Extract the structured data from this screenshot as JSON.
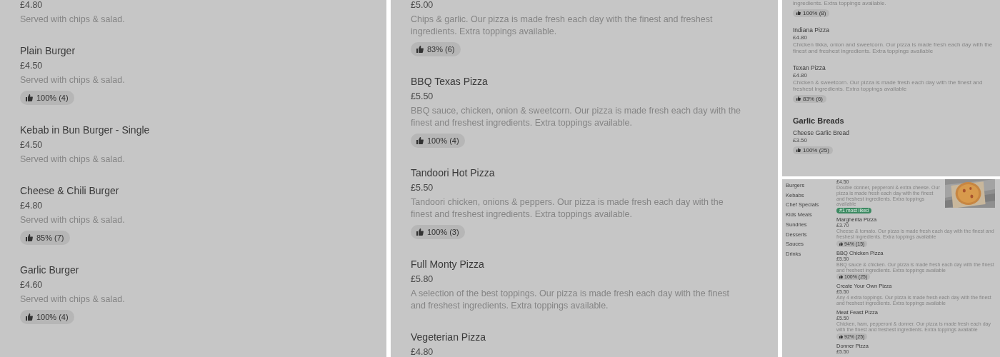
{
  "panels": [
    {
      "kind": "wide",
      "items": [
        {
          "kind": "dish",
          "price": "£4.80",
          "description": "Served with chips & salad."
        },
        {
          "kind": "dish",
          "name": "Plain Burger",
          "price": "£4.50",
          "description": "Served with chips & salad.",
          "rating": "100% (4)"
        },
        {
          "kind": "dish",
          "name": "Kebab in Bun Burger - Single",
          "price": "£4.50",
          "description": "Served with chips & salad."
        },
        {
          "kind": "dish",
          "name": "Cheese & Chili Burger",
          "price": "£4.80",
          "description": "Served with chips & salad.",
          "rating": "85% (7)"
        },
        {
          "kind": "dish",
          "name": "Garlic Burger",
          "price": "£4.60",
          "description": "Served with chips & salad.",
          "rating": "100% (4)"
        }
      ]
    },
    {
      "kind": "wide",
      "items": [
        {
          "kind": "dish",
          "price": "£5.00",
          "description": "Chips & garlic. Our pizza is made fresh each day with the finest and freshest ingredients. Extra toppings available.",
          "rating": "83% (6)"
        },
        {
          "kind": "dish",
          "name": "BBQ Texas Pizza",
          "price": "£5.50",
          "description": "BBQ sauce, chicken, onion & sweetcorn. Our pizza is made fresh each day with the finest and freshest ingredients. Extra toppings available.",
          "rating": "100% (4)"
        },
        {
          "kind": "dish",
          "name": "Tandoori Hot Pizza",
          "price": "£5.50",
          "description": "Tandoori chicken, onions & peppers. Our pizza is made fresh each day with the finest and freshest ingredients. Extra toppings available.",
          "rating": "100% (3)"
        },
        {
          "kind": "dish",
          "name": "Full Monty Pizza",
          "price": "£5.80",
          "description": "A selection of the best toppings. Our pizza is made fresh each day with the finest and freshest ingredients. Extra toppings available."
        },
        {
          "kind": "dish",
          "name": "Vegeterian Pizza",
          "price": "£4.80"
        }
      ]
    },
    {
      "kind": "compact",
      "items": [
        {
          "kind": "dish",
          "description": "ingredients. Extra toppings available.",
          "rating": "100% (8)"
        },
        {
          "kind": "dish",
          "name": "Indiana Pizza",
          "price": "£4.80",
          "description": "Chicken tikka, onion and sweetcorn. Our pizza is made fresh each day with the finest and freshest ingredients. Extra toppings available"
        },
        {
          "kind": "dish",
          "name": "Texan Pizza",
          "price": "£4.80",
          "description": "Chicken & sweetcorn. Our pizza is made fresh each day with the finest and freshest ingredients. Extra toppings available",
          "rating": "83% (6)"
        },
        {
          "kind": "heading",
          "name": "Garlic Breads"
        },
        {
          "kind": "dish",
          "name": "Cheese Garlic Bread",
          "price": "£3.50",
          "rating": "100% (25)"
        }
      ]
    },
    {
      "kind": "sidebar",
      "categories": [
        "Burgers",
        "Kebabs",
        "Chef Specials",
        "Kids Meals",
        "Sundries",
        "Desserts",
        "Sauces",
        "Drinks"
      ],
      "items": [
        {
          "kind": "featured",
          "price": "£4.50",
          "description": "Double donner, pepperoni & extra cheese. Our pizza is made fresh each day with the finest and freshest ingredients. Extra toppings available",
          "badge": "#1 most liked"
        },
        {
          "kind": "dish",
          "name": "Margherita Pizza",
          "price": "£3.70",
          "description": "Cheese & tomato. Our pizza is made fresh each day with the finest and freshest ingredients. Extra toppings available",
          "rating": "94% (15)"
        },
        {
          "kind": "dish",
          "name": "BBQ Chicken Pizza",
          "price": "£5.50",
          "description": "BBQ sauce & chicken. Our pizza is made fresh each day with the finest and freshest ingredients. Extra toppings available",
          "rating": "100% (25)"
        },
        {
          "kind": "dish",
          "name": "Create Your Own Pizza",
          "price": "£5.50",
          "description": "Any 4 extra toppings. Our pizza is made fresh each day with the finest and freshest ingredients. Extra toppings available"
        },
        {
          "kind": "dish",
          "name": "Meat Feast Pizza",
          "price": "£5.50",
          "description": "Chicken, ham, pepperoni & donner. Our pizza is made fresh each day with the finest and freshest ingredients. Extra toppings available",
          "rating": "92% (25)"
        },
        {
          "kind": "dish",
          "name": "Donner Pizza",
          "price": "£5.50"
        }
      ]
    }
  ]
}
